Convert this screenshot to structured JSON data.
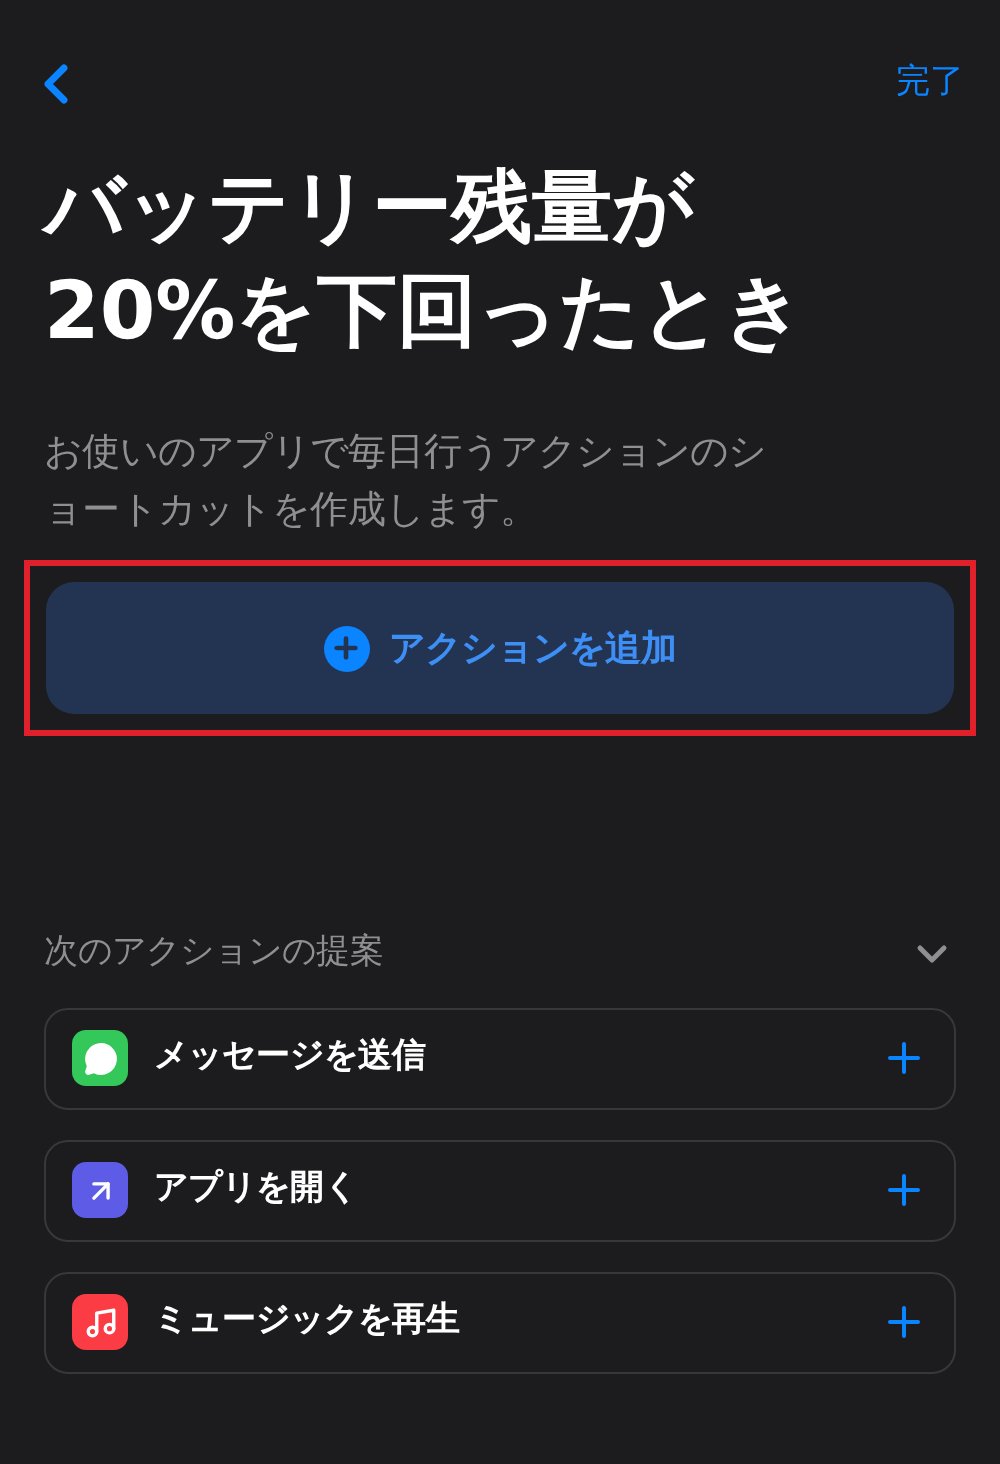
{
  "nav": {
    "done": "完了"
  },
  "title": "バッテリー残量が20%を下回ったとき",
  "description": "お使いのアプリで毎日行うアクションのショートカットを作成します。",
  "add_action": {
    "label": "アクションを追加",
    "highlighted": true
  },
  "suggestions": {
    "header": "次のアクションの提案",
    "expanded": true,
    "items": [
      {
        "kind": "messages",
        "label": "メッセージを送信",
        "color": "#34c759"
      },
      {
        "kind": "open_app",
        "label": "アプリを開く",
        "color": "#5e5ce6"
      },
      {
        "kind": "music",
        "label": "ミュージックを再生",
        "color": "#fc3c44"
      }
    ]
  }
}
